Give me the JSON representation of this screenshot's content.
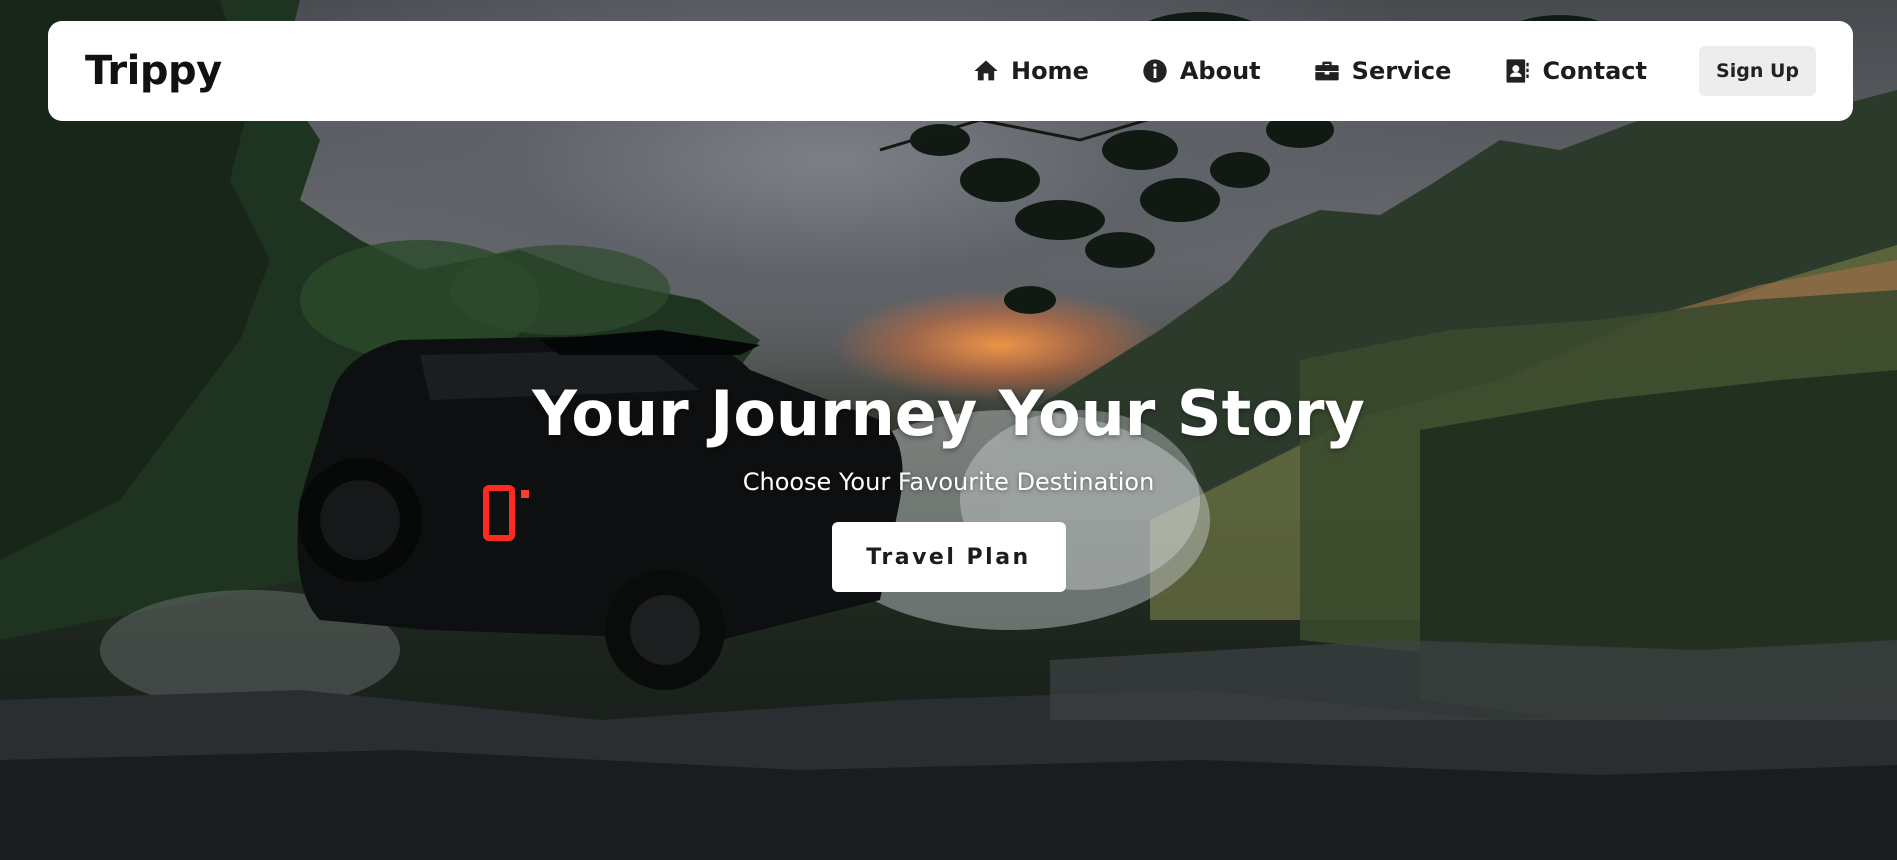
{
  "brand": {
    "name": "Trippy"
  },
  "nav": {
    "items": [
      {
        "label": "Home",
        "icon": "home-icon"
      },
      {
        "label": "About",
        "icon": "info-icon"
      },
      {
        "label": "Service",
        "icon": "briefcase-icon"
      },
      {
        "label": "Contact",
        "icon": "address-book-icon"
      }
    ],
    "signup_label": "Sign Up"
  },
  "hero": {
    "title": "Your Journey Your Story",
    "subtitle": "Choose Your Favourite Destination",
    "cta_label": "Travel Plan",
    "background": "jeep-splashing-through-river-photo"
  },
  "colors": {
    "navbar_bg": "#ffffff",
    "text_dark": "#111111",
    "signup_bg": "#ededed",
    "hero_text": "#ffffff",
    "sunset_accent": "#f6964a"
  }
}
